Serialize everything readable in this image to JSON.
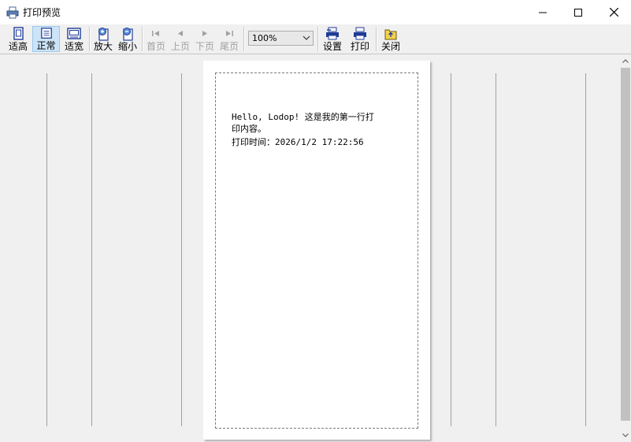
{
  "window": {
    "title": "打印预览",
    "icon": "printer-icon",
    "controls": [
      "minimize-icon",
      "maximize-icon",
      "close-icon"
    ]
  },
  "toolbar": {
    "buttons": [
      {
        "label": "适高",
        "icon": "fit-height-icon",
        "enabled": true,
        "active": false
      },
      {
        "label": "正常",
        "icon": "normal-size-icon",
        "enabled": true,
        "active": true
      },
      {
        "label": "适宽",
        "icon": "fit-width-icon",
        "enabled": true,
        "active": false
      },
      {
        "label": "放大",
        "icon": "zoom-in-icon",
        "enabled": true,
        "active": false
      },
      {
        "label": "缩小",
        "icon": "zoom-out-icon",
        "enabled": true,
        "active": false
      },
      {
        "label": "首页",
        "icon": "first-page-icon",
        "enabled": false,
        "active": false
      },
      {
        "label": "上页",
        "icon": "prev-page-icon",
        "enabled": false,
        "active": false
      },
      {
        "label": "下页",
        "icon": "next-page-icon",
        "enabled": false,
        "active": false
      },
      {
        "label": "尾页",
        "icon": "last-page-icon",
        "enabled": false,
        "active": false
      },
      {
        "label": "设置",
        "icon": "printer-setup-icon",
        "enabled": true,
        "active": false
      },
      {
        "label": "打印",
        "icon": "print-icon",
        "enabled": true,
        "active": false
      },
      {
        "label": "关闭",
        "icon": "close-folder-icon",
        "enabled": true,
        "active": false
      }
    ],
    "zoom": {
      "value": "100%"
    }
  },
  "page": {
    "line1": "Hello, Lodop! 这是我的第一行打印内容。",
    "line2": "打印时间：2026/1/2 17:22:56"
  },
  "colors": {
    "toolbar_bg": "#f0f0f0",
    "active_button_bg": "#cce4f7",
    "disabled_text": "#a0a0a0",
    "preview_bg": "#f0f0f0",
    "icon_blue": "#1e3c96"
  }
}
